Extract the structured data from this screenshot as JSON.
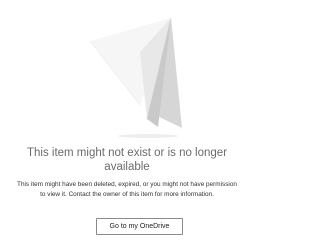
{
  "error": {
    "title": "This item might not exist or is no longer available",
    "description": "This item might have been deleted, expired, or you might not have permission to view it. Contact the owner of this item for more information.",
    "action_label": "Go to my OneDrive"
  },
  "illustration": {
    "icon": "paper-plane-icon"
  },
  "colors": {
    "background": "#ffffff",
    "title_text": "#6b6b6b",
    "body_text": "#333333",
    "button_border": "#8a8a8a"
  }
}
